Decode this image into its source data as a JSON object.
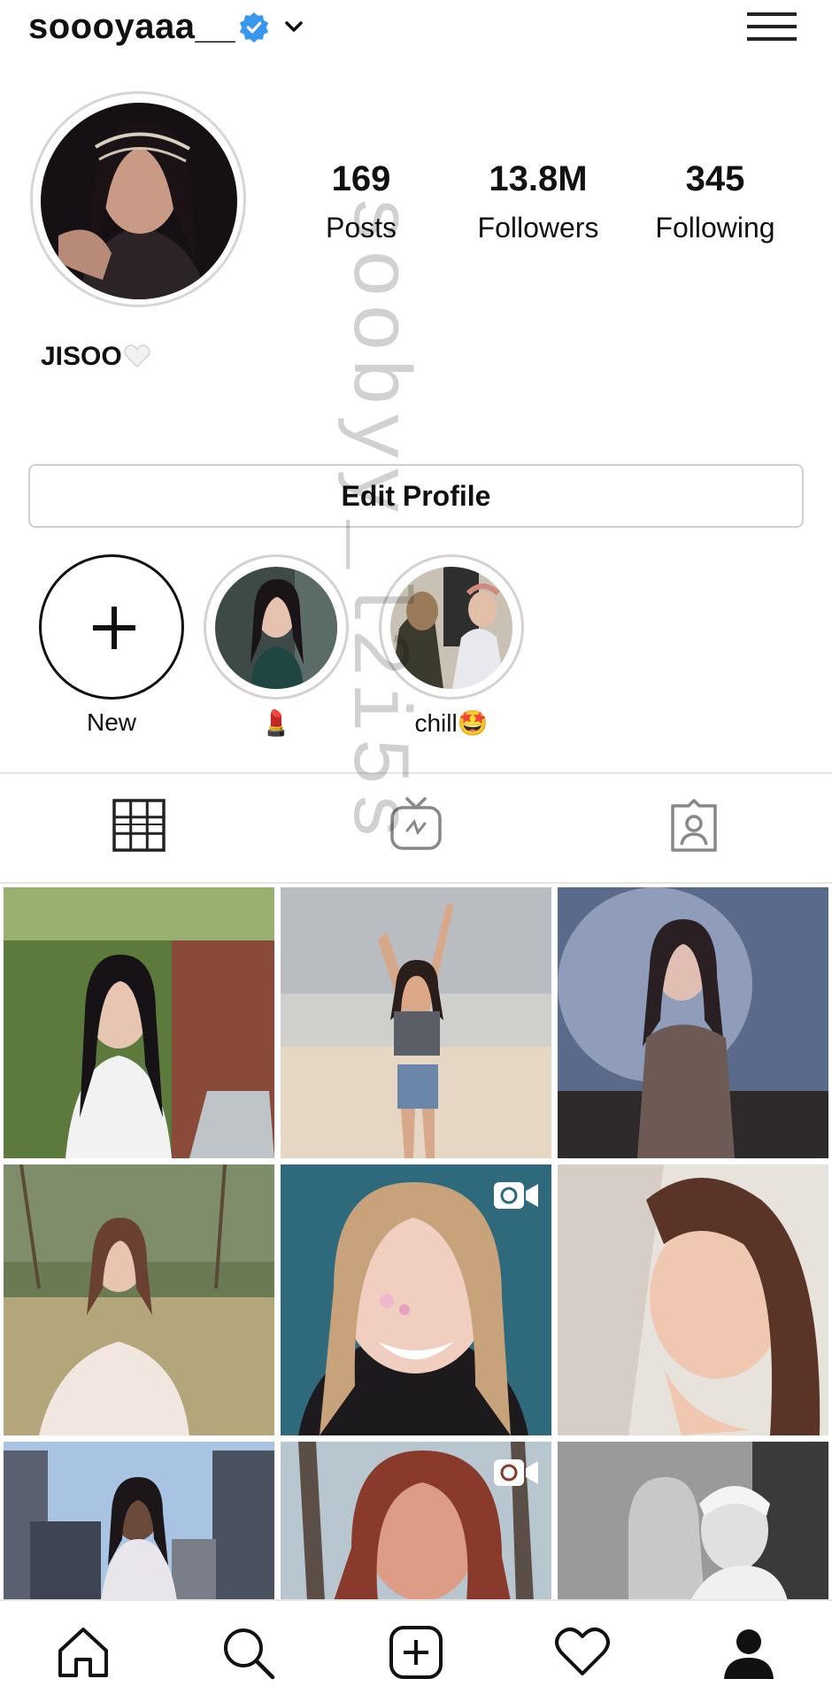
{
  "header": {
    "username": "soooyaaa__",
    "verified_icon": "verified-badge-icon",
    "dropdown_icon": "chevron-down-icon",
    "menu_icon": "hamburger-menu-icon",
    "accent_color": "#3897f0"
  },
  "profile": {
    "avatar_icon": "profile-avatar",
    "stats": [
      {
        "value": "169",
        "label": "Posts"
      },
      {
        "value": "13.8M",
        "label": "Followers"
      },
      {
        "value": "345",
        "label": "Following"
      }
    ],
    "bio_name": "JISOO",
    "edit_button": "Edit Profile"
  },
  "highlights": [
    {
      "label": "New",
      "icon": "plus-icon"
    },
    {
      "label": "💄"
    },
    {
      "label": "chill🤩"
    }
  ],
  "tabs": [
    {
      "icon": "grid-icon",
      "active": true
    },
    {
      "icon": "igtv-icon",
      "active": false
    },
    {
      "icon": "tagged-icon",
      "active": false
    }
  ],
  "bottom_nav": [
    {
      "icon": "home-icon"
    },
    {
      "icon": "search-icon"
    },
    {
      "icon": "new-post-icon"
    },
    {
      "icon": "activity-heart-icon"
    },
    {
      "icon": "profile-icon"
    }
  ],
  "watermark": "soobyy_l2i5s"
}
